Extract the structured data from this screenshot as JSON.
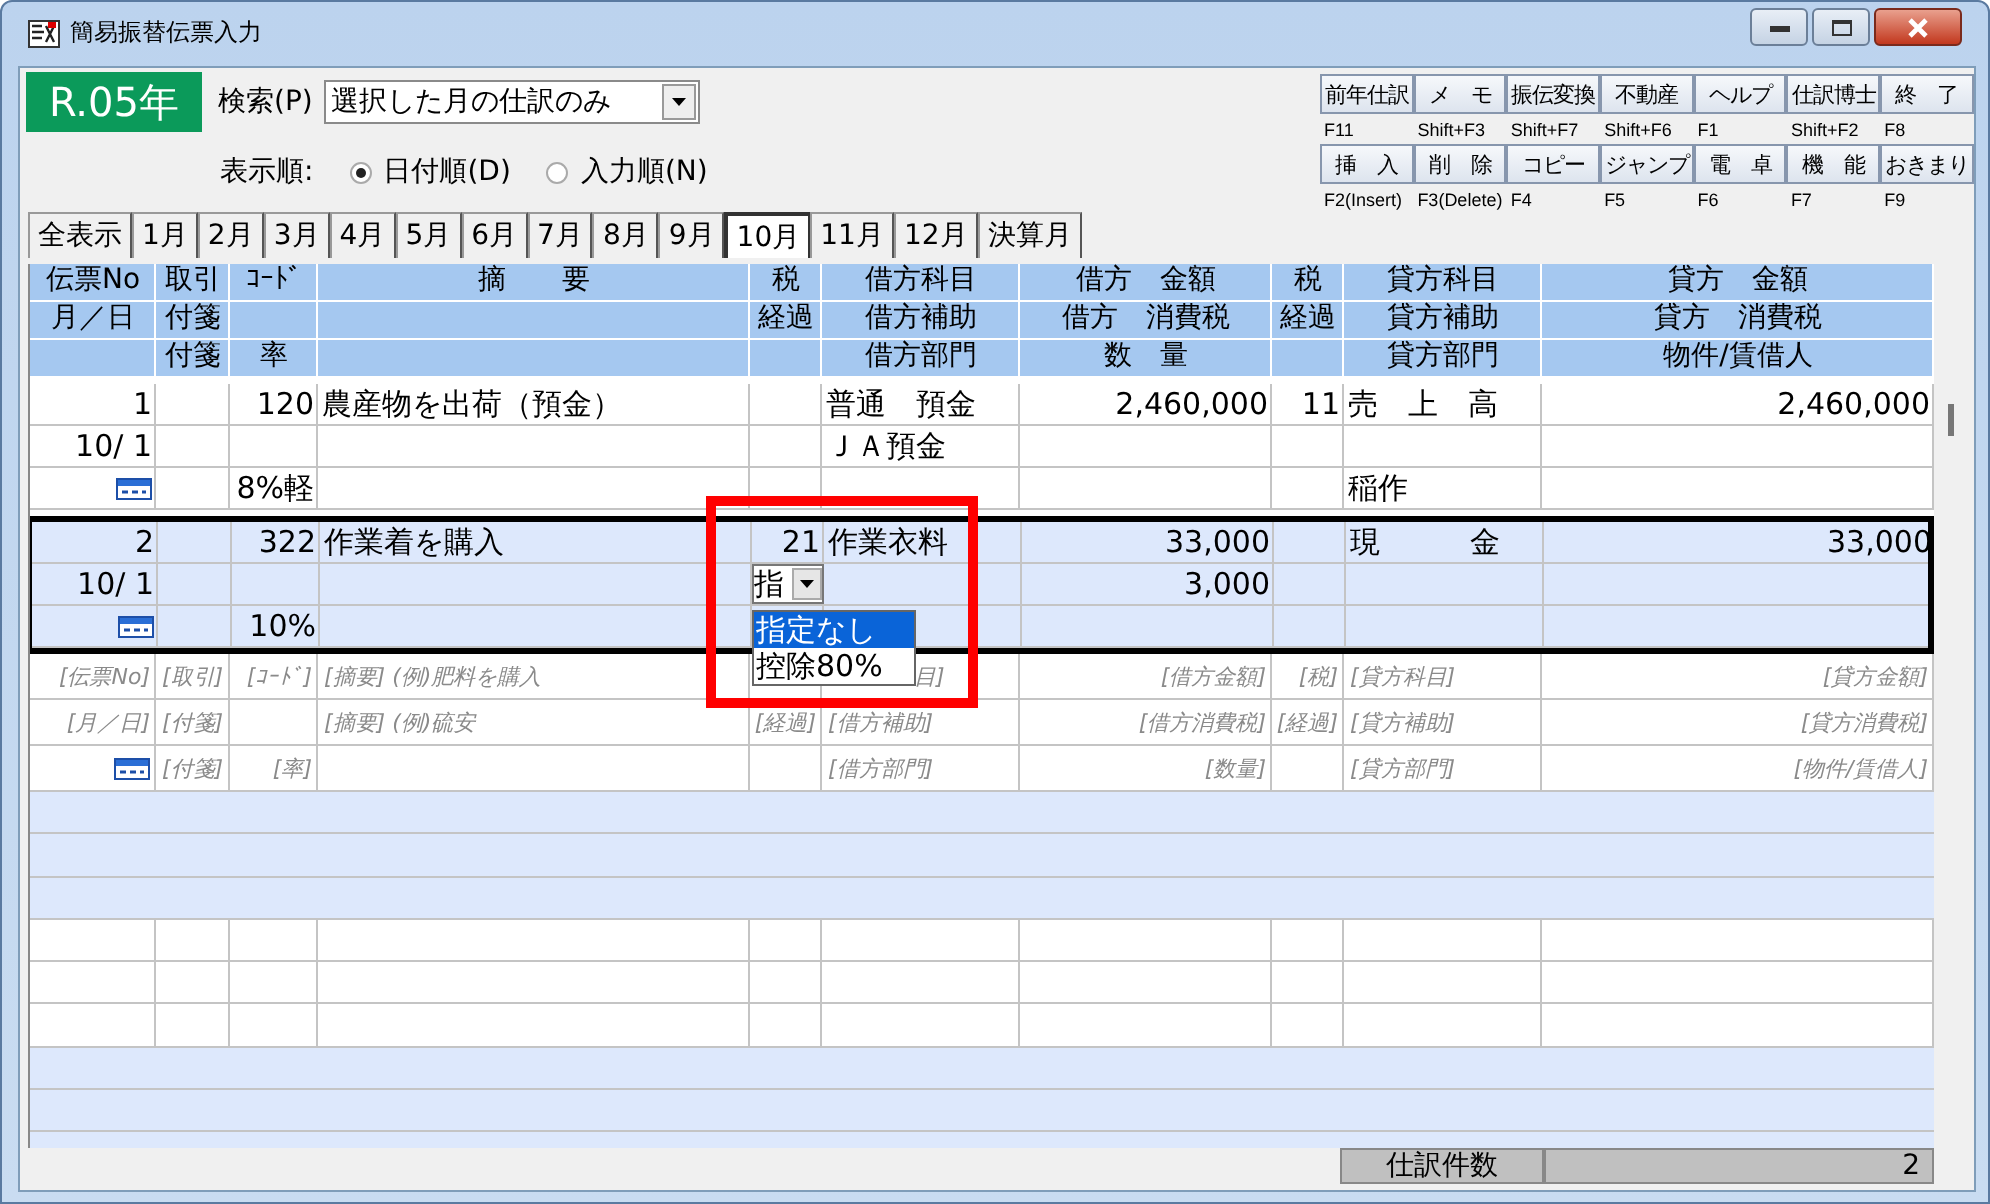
{
  "window": {
    "title": "簡易振替伝票入力"
  },
  "year_badge": "R.05年",
  "search": {
    "label": "検索(P)",
    "value": "選択した月の仕訳のみ"
  },
  "sort": {
    "label": "表示順:",
    "options": [
      {
        "label": "日付順(D)",
        "selected": true
      },
      {
        "label": "入力順(N)",
        "selected": false
      }
    ]
  },
  "function_keys": [
    [
      {
        "label": "前年仕訳",
        "key": "F11"
      },
      {
        "label": "メ　モ",
        "key": "Shift+F3"
      },
      {
        "label": "振伝変換",
        "key": "Shift+F7"
      },
      {
        "label": "不動産",
        "key": "Shift+F6"
      },
      {
        "label": "ヘルプ",
        "key": "F1"
      },
      {
        "label": "仕訳博士",
        "key": "Shift+F2"
      },
      {
        "label": "終　了",
        "key": "F8"
      }
    ],
    [
      {
        "label": "挿　入",
        "key": "F2(Insert)"
      },
      {
        "label": "削　除",
        "key": "F3(Delete)"
      },
      {
        "label": "コピー",
        "key": "F4"
      },
      {
        "label": "ジャンプ",
        "key": "F5"
      },
      {
        "label": "電　卓",
        "key": "F6"
      },
      {
        "label": "機　能",
        "key": "F7"
      },
      {
        "label": "おきまり",
        "key": "F9"
      }
    ]
  ],
  "month_tabs": [
    {
      "label": "全表示",
      "selected": false
    },
    {
      "label": "1月",
      "selected": false
    },
    {
      "label": "2月",
      "selected": false
    },
    {
      "label": "3月",
      "selected": false
    },
    {
      "label": "4月",
      "selected": false
    },
    {
      "label": "5月",
      "selected": false
    },
    {
      "label": "6月",
      "selected": false
    },
    {
      "label": "7月",
      "selected": false
    },
    {
      "label": "8月",
      "selected": false
    },
    {
      "label": "9月",
      "selected": false
    },
    {
      "label": "10月",
      "selected": true
    },
    {
      "label": "11月",
      "selected": false
    },
    {
      "label": "12月",
      "selected": false
    },
    {
      "label": "決算月",
      "selected": false
    }
  ],
  "table": {
    "header": [
      {
        "line_1": "伝票No",
        "line_2": "月／日"
      },
      {
        "line_1": "取引",
        "line_2": "付箋",
        "line_3": "付箋"
      },
      {
        "line_1": "ｺｰﾄﾞ",
        "line_3": "率"
      },
      {
        "line_1": "摘　　要"
      },
      {
        "line_1": "税",
        "line_2": "経過"
      },
      {
        "line_1": "借方科目",
        "line_2": "借方補助",
        "line_3": "借方部門"
      },
      {
        "line_1": "借方　金額",
        "line_2": "借方　消費税",
        "line_3": "数　量"
      },
      {
        "line_1": "税",
        "line_2": "経過"
      },
      {
        "line_1": "貸方科目",
        "line_2": "貸方補助",
        "line_3": "貸方部門"
      },
      {
        "line_1": "貸方　金額",
        "line_2": "貸方　消費税",
        "line_3": "物件/賃借人"
      }
    ],
    "entries": [
      {
        "selected": false,
        "rows": [
          {
            "kind": "main",
            "cells": [
              "1",
              "",
              "120",
              "農産物を出荷（預金）",
              "",
              "普通　預金",
              "2,460,000",
              "11",
              "売　上　高",
              "2,460,000"
            ]
          },
          {
            "kind": "date",
            "cells": [
              "10/ 1",
              "",
              "",
              "",
              "",
              "ＪＡ預金",
              "",
              "",
              "",
              ""
            ]
          },
          {
            "kind": "memo",
            "cells": [
              "",
              "",
              "8%軽",
              "",
              "",
              "",
              "",
              "",
              "稲作",
              ""
            ]
          }
        ]
      },
      {
        "selected": true,
        "rows": [
          {
            "kind": "main",
            "cells": [
              "2",
              "",
              "322",
              "作業着を購入",
              "21",
              "作業衣料",
              "33,000",
              "",
              "現　　　金",
              "33,000"
            ]
          },
          {
            "kind": "date",
            "cells": [
              "10/ 1",
              "",
              "",
              "",
              "",
              "",
              "3,000",
              "",
              "",
              ""
            ]
          },
          {
            "kind": "memo",
            "cells": [
              "",
              "",
              "10%",
              "",
              "",
              "",
              "",
              "",
              "",
              ""
            ]
          }
        ],
        "dropdown": {
          "value": "指",
          "options": [
            {
              "label": "指定なし",
              "selected": true
            },
            {
              "label": "控除80%",
              "selected": false
            }
          ]
        }
      }
    ],
    "placeholder_rows": [
      {
        "kind": "main",
        "cells": [
          "[伝票No]",
          "[取引]",
          "[ｺｰﾄﾞ]",
          "[摘要] (例)肥料を購入",
          "",
          "目]",
          "[借方金額]",
          "[税]",
          "[貸方科目]",
          "[貸方金額]"
        ]
      },
      {
        "kind": "date",
        "cells": [
          "[月／日]",
          "[付箋]",
          "",
          "[摘要] (例)硫安",
          "[経過]",
          "[借方補助]",
          "[借方消費税]",
          "[経過]",
          "[貸方補助]",
          "[貸方消費税]"
        ]
      },
      {
        "kind": "memo",
        "cells": [
          "",
          "[付箋]",
          "[率]",
          "",
          "",
          "[借方部門]",
          "[数量]",
          "",
          "[貸方部門]",
          "[物件/賃借人]"
        ]
      }
    ]
  },
  "status_bar": {
    "label": "仕訳件数",
    "value": "2"
  }
}
